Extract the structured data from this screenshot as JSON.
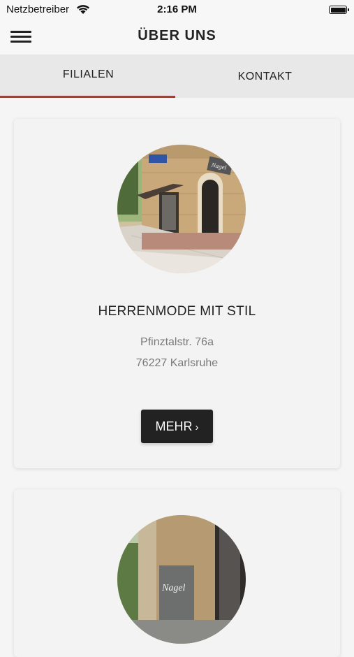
{
  "status_bar": {
    "carrier": "Netzbetreiber",
    "time": "2:16 PM"
  },
  "header": {
    "title": "ÜBER UNS",
    "menu_icon": "hamburger-menu-icon"
  },
  "tabs": [
    {
      "label": "FILIALEN",
      "selected": true
    },
    {
      "label": "KONTAKT",
      "selected": false
    }
  ],
  "colors": {
    "accent": "#c4302b",
    "button_bg": "#222222"
  },
  "stores": [
    {
      "name": "HERRENMODE MIT STIL",
      "street": "Pfinztalstr. 76a",
      "city": "76227 Karlsruhe",
      "button_label": "MEHR",
      "photo_sign": "Nagel"
    },
    {
      "photo_sign": "Nagel"
    }
  ]
}
